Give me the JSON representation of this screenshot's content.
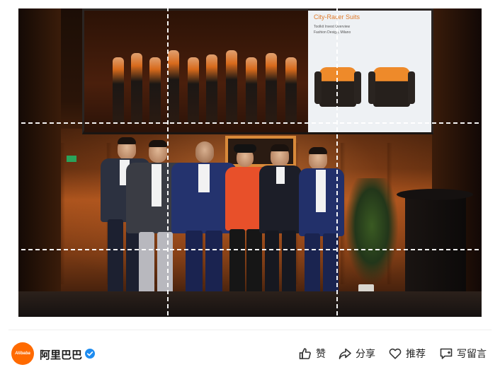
{
  "photo": {
    "slide": {
      "title": "City-Racer Suits",
      "line1": "Toolkit Invest Overview",
      "line2": "Fashion Design, Milano"
    }
  },
  "author": {
    "avatar_text": "Alibaba",
    "name": "阿里巴巴",
    "verified": true,
    "brand_color": "#ff6a00",
    "verified_color": "#1e8cf0"
  },
  "actions": [
    {
      "label": "赞",
      "icon": "thumbs-up-icon"
    },
    {
      "label": "分享",
      "icon": "share-icon"
    },
    {
      "label": "推荐",
      "icon": "heart-icon"
    },
    {
      "label": "写留言",
      "icon": "comment-icon"
    }
  ]
}
